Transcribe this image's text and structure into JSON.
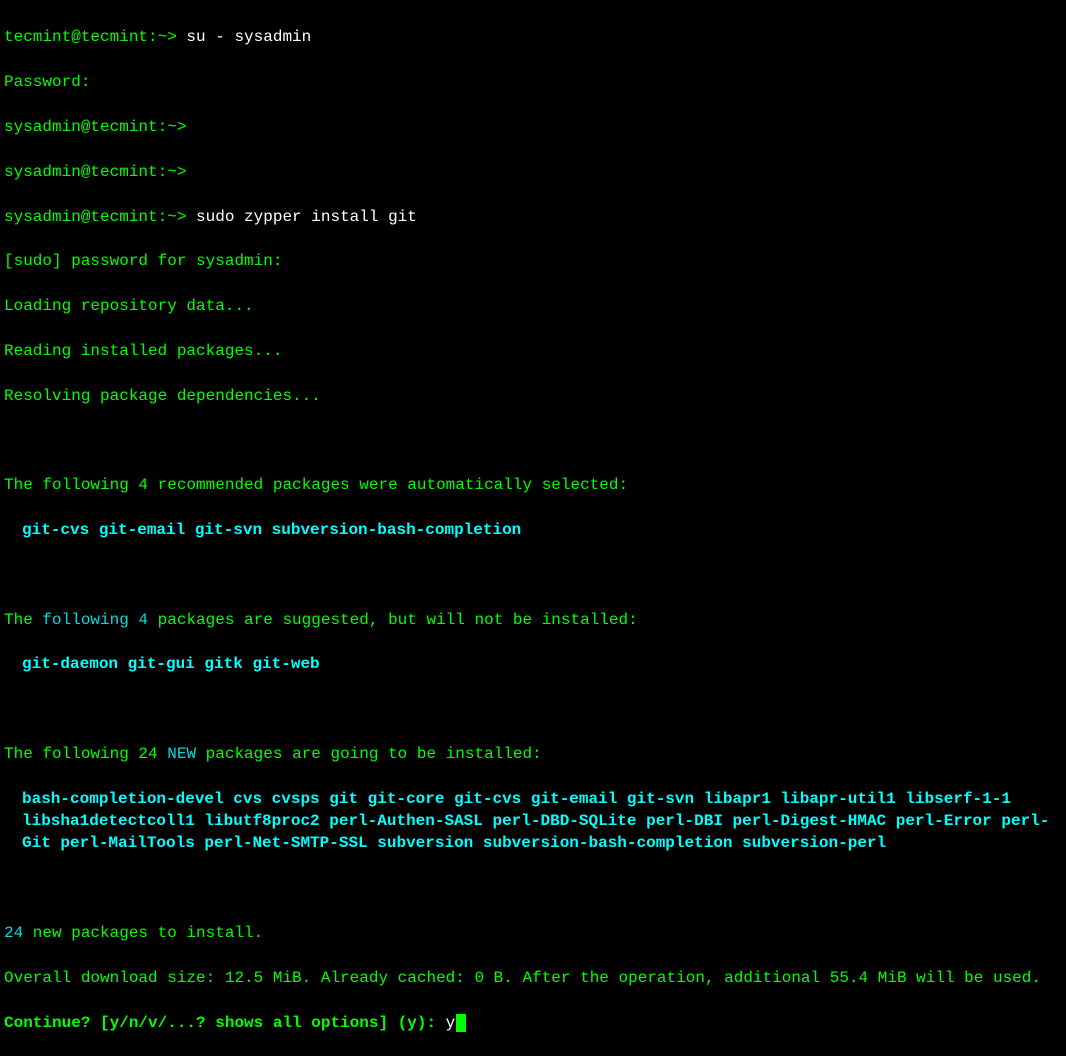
{
  "lines": {
    "l1_prompt": "tecmint@tecmint:~>",
    "l1_cmd": " su - sysadmin",
    "l2": "Password:",
    "l3": "sysadmin@tecmint:~>",
    "l4": "sysadmin@tecmint:~>",
    "l5_prompt": "sysadmin@tecmint:~>",
    "l5_cmd": " sudo zypper install git",
    "l6": "[sudo] password for sysadmin:",
    "l7": "Loading repository data...",
    "l8": "Reading installed packages...",
    "l9": "Resolving package dependencies...",
    "l10_a": "The following 4 recommended packages were automatically selected:",
    "l10_pkgs": "git-cvs git-email git-svn subversion-bash-completion",
    "l11_a": "The ",
    "l11_b": "following 4",
    "l11_c": " packages are suggested, but will not be installed:",
    "l11_pkgs": "git-daemon git-gui gitk git-web",
    "l12_a": "The following 24 ",
    "l12_b": "NEW",
    "l12_c": " packages are going to be installed:",
    "l12_pkgs": "bash-completion-devel cvs cvsps git git-core git-cvs git-email git-svn libapr1 libapr-util1 libserf-1-1 libsha1detectcoll1 libutf8proc2 perl-Authen-SASL perl-DBD-SQLite perl-DBI perl-Digest-HMAC perl-Error perl-Git perl-MailTools perl-Net-SMTP-SSL subversion subversion-bash-completion subversion-perl",
    "l13_a": "24",
    "l13_b": " new packages to install.",
    "l14": "Overall download size: 12.5 MiB. Already cached: 0 B. After the operation, additional 55.4 MiB will be used.",
    "l15_a": "Continue? [y/n/v/...? shows all options] (y): ",
    "l15_input": "y"
  }
}
